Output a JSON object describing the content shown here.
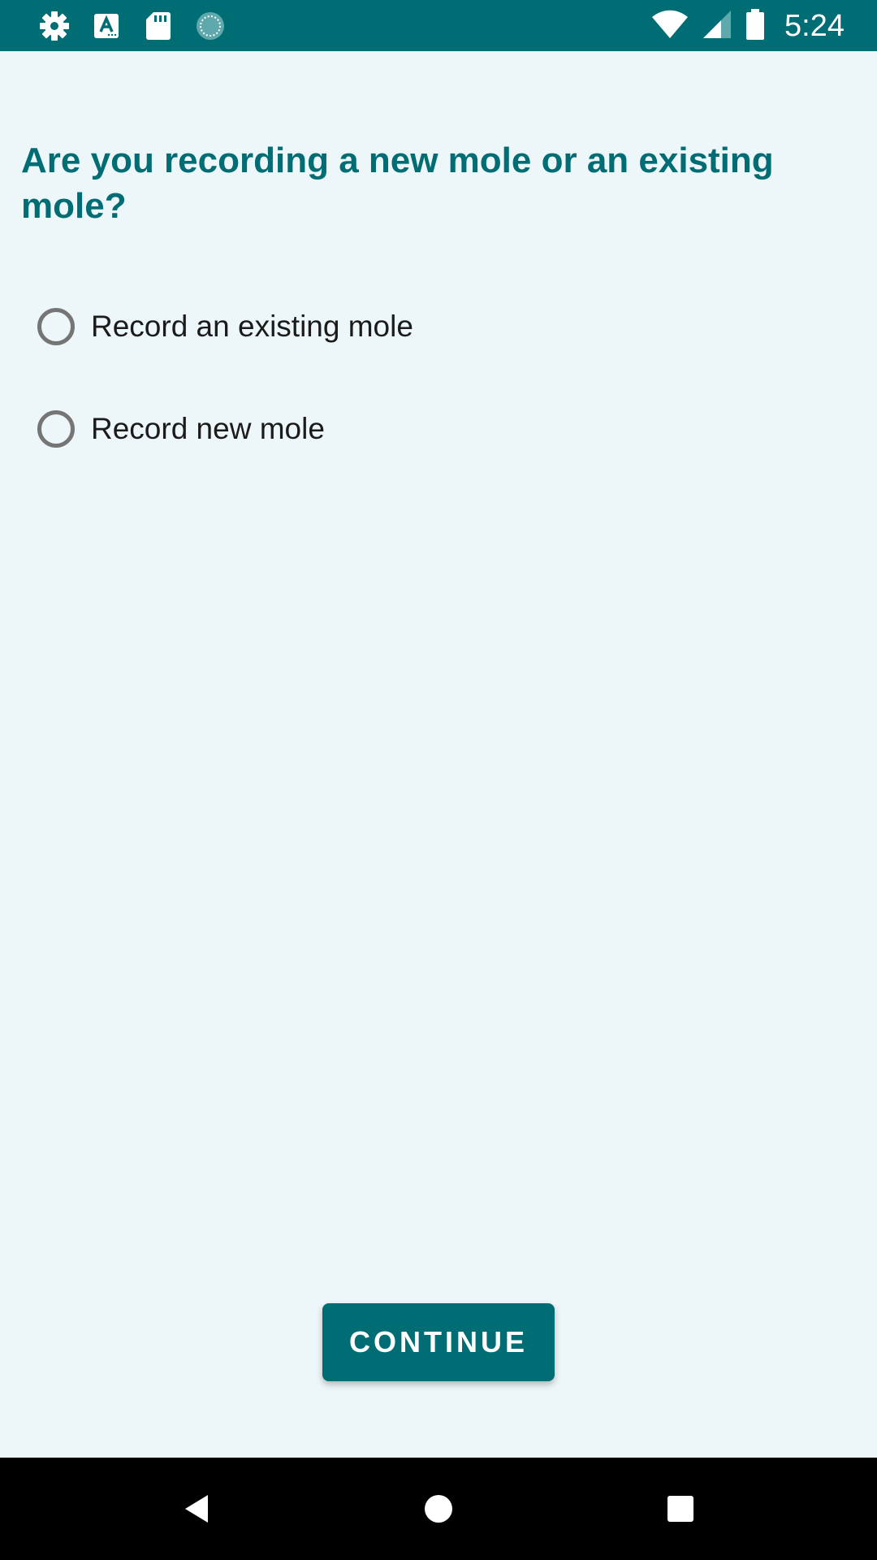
{
  "status_bar": {
    "time": "5:24",
    "left_icons": [
      "gear-icon",
      "text-a-icon",
      "sd-card-icon",
      "sync-progress-icon"
    ],
    "right_icons": [
      "wifi-icon",
      "cell-signal-icon",
      "battery-icon"
    ]
  },
  "screen": {
    "question": "Are you recording a new mole or an existing mole?",
    "options": [
      {
        "label": "Record an existing mole",
        "selected": false
      },
      {
        "label": "Record new mole",
        "selected": false
      }
    ],
    "continue_label": "CONTINUE"
  },
  "nav_bar": {
    "buttons": [
      "back-icon",
      "home-icon",
      "recents-icon"
    ]
  },
  "colors": {
    "accent": "#006d75",
    "background": "#edf6f8",
    "radio_border": "#757575",
    "text": "#1b1b1b"
  }
}
